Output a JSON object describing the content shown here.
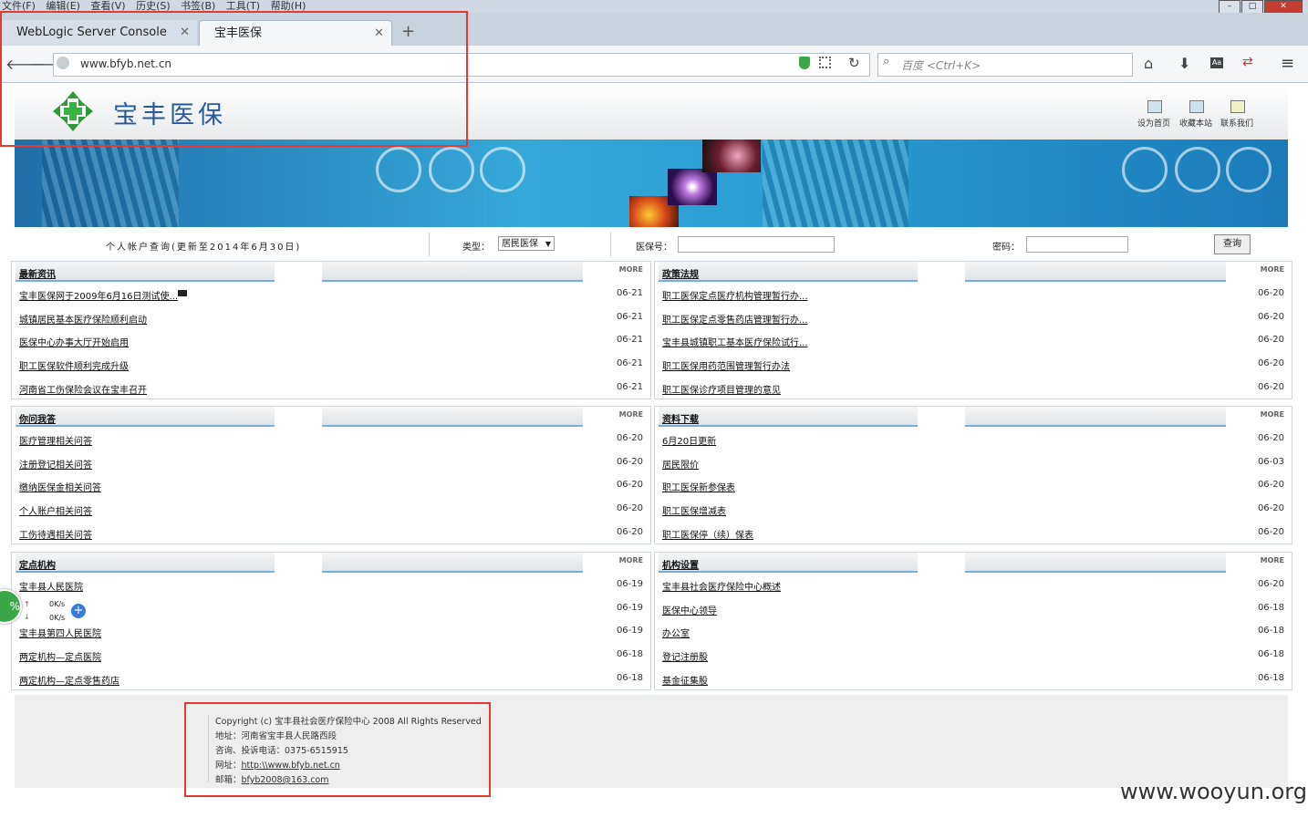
{
  "browser": {
    "menu": [
      "文件(F)",
      "编辑(E)",
      "查看(V)",
      "历史(S)",
      "书签(B)",
      "工具(T)",
      "帮助(H)"
    ],
    "tabs": [
      {
        "label": "WebLogic Server Console"
      },
      {
        "label": "宝丰医保"
      }
    ],
    "url": "www.bfyb.net.cn",
    "search_placeholder": "百度 <Ctrl+K>"
  },
  "site": {
    "logo_text": "宝丰医保",
    "top_links": [
      "设为首页",
      "收藏本站",
      "联系我们"
    ]
  },
  "query": {
    "title": "个人帐户查询(更新至2014年6月30日)",
    "type_label": "类型：",
    "type_value": "居民医保",
    "id_label": "医保号：",
    "pwd_label": "密码：",
    "button": "查询"
  },
  "panels": [
    {
      "title": "最新资讯",
      "more": "MORE",
      "items": [
        {
          "text": "宝丰医保网于2009年6月16日测试使...",
          "date": "06-21"
        },
        {
          "text": "城镇居民基本医疗保险顺利启动",
          "date": "06-21"
        },
        {
          "text": "医保中心办事大厅开始启用",
          "date": "06-21"
        },
        {
          "text": "职工医保软件顺利完成升级",
          "date": "06-21"
        },
        {
          "text": "河南省工伤保险会议在宝丰召开",
          "date": "06-21"
        }
      ]
    },
    {
      "title": "政策法规",
      "more": "MORE",
      "items": [
        {
          "text": "职工医保定点医疗机构管理暂行办...",
          "date": "06-20"
        },
        {
          "text": "职工医保定点零售药店管理暂行办...",
          "date": "06-20"
        },
        {
          "text": "宝丰县城镇职工基本医疗保险试行...",
          "date": "06-20"
        },
        {
          "text": "职工医保用药范围管理暂行办法",
          "date": "06-20"
        },
        {
          "text": "职工医保诊疗项目管理的意见",
          "date": "06-20"
        }
      ]
    },
    {
      "title": "你问我答",
      "more": "MORE",
      "items": [
        {
          "text": "医疗管理相关问答",
          "date": "06-20"
        },
        {
          "text": "注册登记相关问答",
          "date": "06-20"
        },
        {
          "text": "缴纳医保金相关问答",
          "date": "06-20"
        },
        {
          "text": "个人账户相关问答",
          "date": "06-20"
        },
        {
          "text": "工伤待遇相关问答",
          "date": "06-20"
        }
      ]
    },
    {
      "title": "资料下载",
      "more": "MORE",
      "items": [
        {
          "text": "6月20日更新",
          "date": "06-20"
        },
        {
          "text": "居民限价",
          "date": "06-03"
        },
        {
          "text": "职工医保新参保表",
          "date": "06-20"
        },
        {
          "text": "职工医保增减表",
          "date": "06-20"
        },
        {
          "text": "职工医保停（续）保表",
          "date": "06-20"
        }
      ]
    },
    {
      "title": "定点机构",
      "more": "MORE",
      "items": [
        {
          "text": "宝丰县人民医院",
          "date": "06-19"
        },
        {
          "text": "",
          "date": "06-19"
        },
        {
          "text": "宝丰县第四人民医院",
          "date": "06-19"
        },
        {
          "text": "两定机构—定点医院",
          "date": "06-18"
        },
        {
          "text": "两定机构—定点零售药店",
          "date": "06-18"
        }
      ]
    },
    {
      "title": "机构设置",
      "more": "MORE",
      "items": [
        {
          "text": "宝丰县社会医疗保险中心概述",
          "date": "06-20"
        },
        {
          "text": "医保中心领导",
          "date": "06-18"
        },
        {
          "text": "办公室",
          "date": "06-18"
        },
        {
          "text": "登记注册股",
          "date": "06-18"
        },
        {
          "text": "基金征集股",
          "date": "06-18"
        }
      ]
    }
  ],
  "footer": {
    "copyright": "Copyright (c) 宝丰县社会医疗保险中心 2008 All Rights Reserved",
    "address": "地址：河南省宝丰县人民路西段",
    "phone": "咨询、投诉电话：0375-6515915",
    "site_label": "网址：",
    "site_url": "http:\\\\www.bfyb.net.cn",
    "email_label": "邮箱：",
    "email": "bfyb2008@163.com"
  },
  "speed_widget": {
    "up": "0K/s",
    "down": "0K/s",
    "percent": "%"
  },
  "watermark": "www.wooyun.org",
  "colors": {
    "highlight_box": "#e53935",
    "banner": "#2a9ed2",
    "logo_green": "#2e9a3a"
  }
}
